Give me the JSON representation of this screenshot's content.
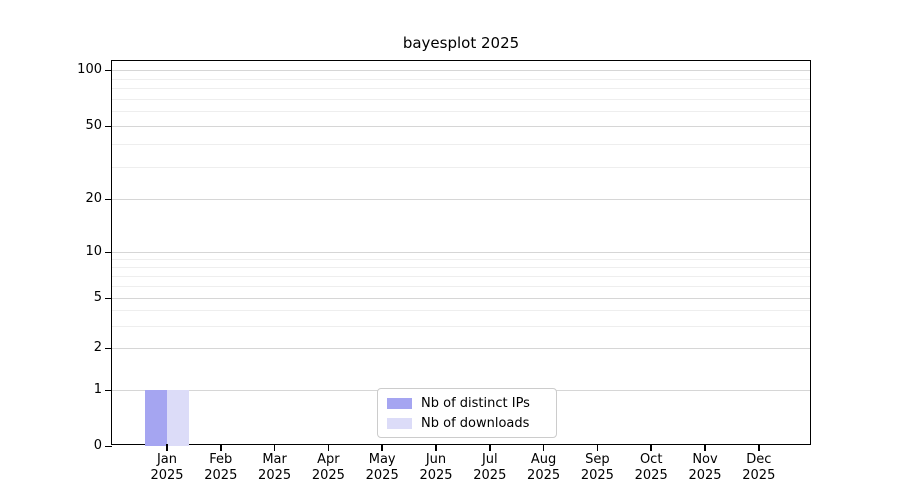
{
  "chart_data": {
    "type": "bar",
    "title": "bayesplot 2025",
    "categories": [
      "Jan",
      "Feb",
      "Mar",
      "Apr",
      "May",
      "Jun",
      "Jul",
      "Aug",
      "Sep",
      "Oct",
      "Nov",
      "Dec"
    ],
    "category_year": "2025",
    "series": [
      {
        "name": "Nb of distinct IPs",
        "color": "#a5a5f1",
        "values": [
          1,
          0,
          0,
          0,
          0,
          0,
          0,
          0,
          0,
          0,
          0,
          0
        ]
      },
      {
        "name": "Nb of downloads",
        "color": "#dcdcf8",
        "values": [
          1,
          0,
          0,
          0,
          0,
          0,
          0,
          0,
          0,
          0,
          0,
          0
        ]
      }
    ],
    "yaxis": {
      "scale": "log-like (0 baseline + log decades)",
      "ticks": [
        0,
        1,
        2,
        5,
        10,
        20,
        50,
        100
      ],
      "minor_gridlines": [
        3,
        4,
        6,
        7,
        8,
        9,
        30,
        40,
        60,
        70,
        80,
        90
      ],
      "ylim": [
        0,
        115
      ]
    },
    "xaxis": {
      "tick_label_format": "month over year, two lines"
    },
    "legend": {
      "position": "lower center, inside plot"
    },
    "grid": {
      "horizontal": true,
      "vertical": false
    }
  }
}
